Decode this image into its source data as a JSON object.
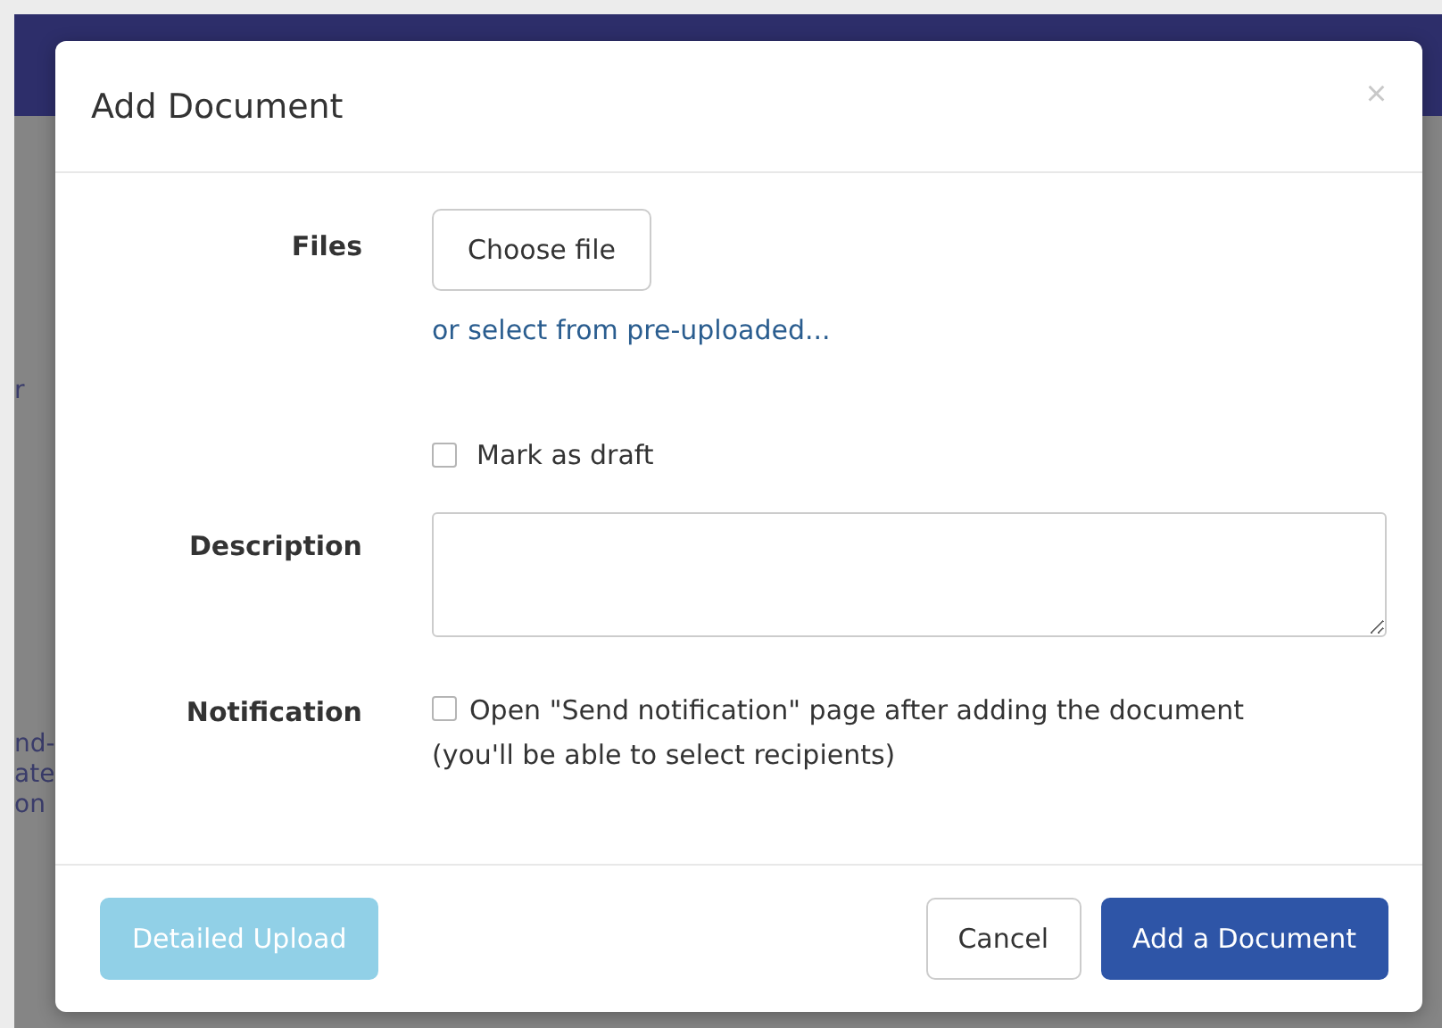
{
  "background": {
    "side_fragments": [
      "r",
      "nd-",
      "ate",
      "on"
    ]
  },
  "dialog": {
    "title": "Add Document",
    "close": "×",
    "files": {
      "label": "Files",
      "button": "Choose file",
      "link": "or select from pre-uploaded..."
    },
    "draft": {
      "label": "Mark as draft",
      "checked": false
    },
    "description": {
      "label": "Description"
    },
    "notification": {
      "label": "Notification",
      "option": "Open \"Send notification\" page after adding the document (you'll be able to select recipients)",
      "checked": false
    },
    "footer": {
      "buttons": [
        {
          "label": "Detailed Upload",
          "kind": "light",
          "disabled": true
        },
        {
          "label": "Cancel",
          "kind": "outline",
          "disabled": false
        },
        {
          "label": "Add a Document",
          "kind": "primary",
          "disabled": false
        }
      ]
    }
  }
}
